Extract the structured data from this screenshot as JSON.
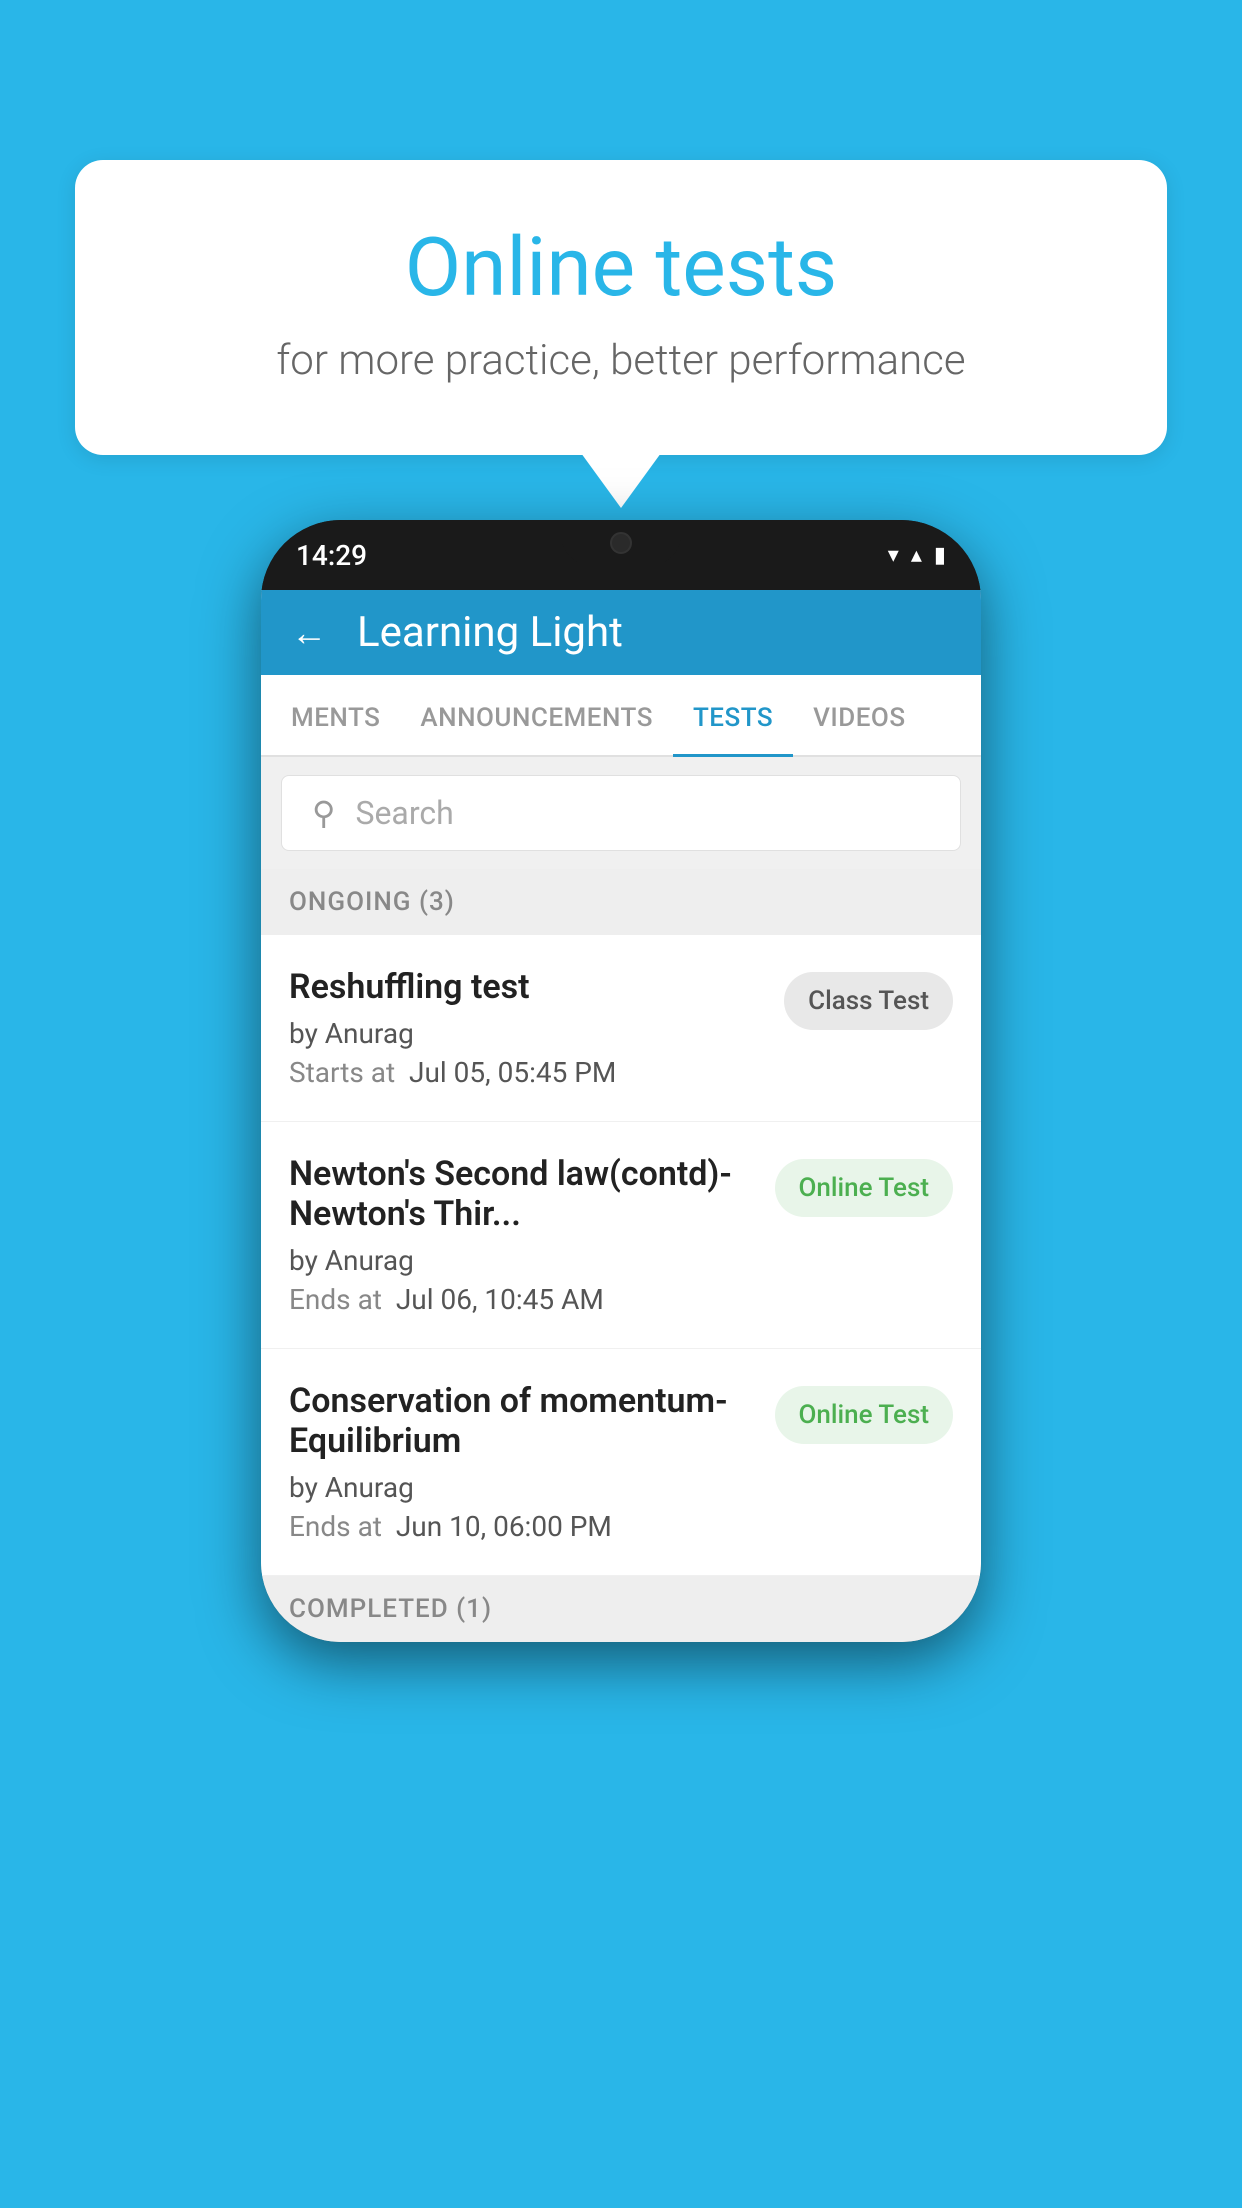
{
  "background": {
    "color": "#29B6E8"
  },
  "speech_bubble": {
    "title": "Online tests",
    "subtitle": "for more practice, better performance"
  },
  "phone": {
    "status_bar": {
      "time": "14:29",
      "wifi_icon": "▼",
      "signal_icon": "▲",
      "battery_icon": "▮"
    },
    "header": {
      "back_label": "←",
      "title": "Learning Light"
    },
    "tabs": [
      {
        "label": "MENTS",
        "active": false
      },
      {
        "label": "ANNOUNCEMENTS",
        "active": false
      },
      {
        "label": "TESTS",
        "active": true
      },
      {
        "label": "VIDEOS",
        "active": false
      }
    ],
    "search": {
      "placeholder": "Search"
    },
    "ongoing_section": {
      "label": "ONGOING (3)"
    },
    "tests": [
      {
        "name": "Reshuffling test",
        "author": "by Anurag",
        "time_label": "Starts at",
        "time": "Jul 05, 05:45 PM",
        "badge": "Class Test",
        "badge_type": "class"
      },
      {
        "name": "Newton's Second law(contd)-Newton's Thir...",
        "author": "by Anurag",
        "time_label": "Ends at",
        "time": "Jul 06, 10:45 AM",
        "badge": "Online Test",
        "badge_type": "online"
      },
      {
        "name": "Conservation of momentum-Equilibrium",
        "author": "by Anurag",
        "time_label": "Ends at",
        "time": "Jun 10, 06:00 PM",
        "badge": "Online Test",
        "badge_type": "online"
      }
    ],
    "completed_section": {
      "label": "COMPLETED (1)"
    }
  }
}
